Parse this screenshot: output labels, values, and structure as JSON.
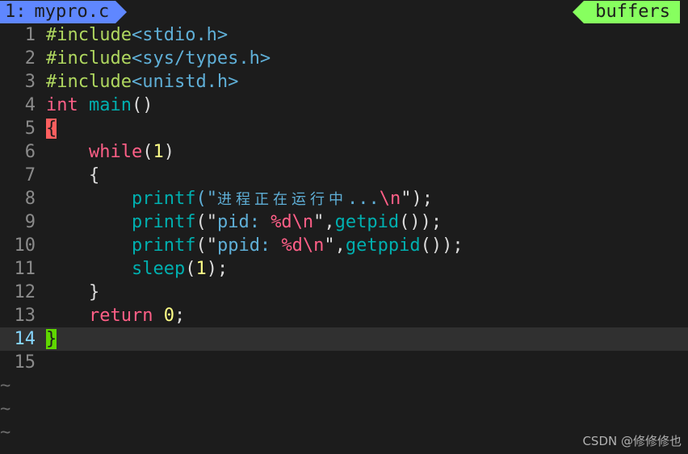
{
  "tabline": {
    "active_tab_number": "1:",
    "active_tab_name": "mypro.c",
    "buffers_label": "buffers"
  },
  "lines": [
    {
      "num": "1"
    },
    {
      "num": "2"
    },
    {
      "num": "3"
    },
    {
      "num": "4"
    },
    {
      "num": "5"
    },
    {
      "num": "6"
    },
    {
      "num": "7"
    },
    {
      "num": "8"
    },
    {
      "num": "9"
    },
    {
      "num": "10"
    },
    {
      "num": "11"
    },
    {
      "num": "12"
    },
    {
      "num": "13"
    },
    {
      "num": "14"
    },
    {
      "num": "15"
    }
  ],
  "code": {
    "l1_pp": "#include",
    "l1_hdr": "<stdio.h>",
    "l2_pp": "#include",
    "l2_hdr": "<sys/types.h>",
    "l3_pp": "#include",
    "l3_hdr": "<unistd.h>",
    "l4_type": "int",
    "l4_func": "main",
    "l4_paren": "()",
    "l5_brace": "{",
    "l6_kw": "while",
    "l6_open": "(",
    "l6_num": "1",
    "l6_close": ")",
    "l7_brace": "{",
    "l8_fn": "printf",
    "l8_open": "(\"",
    "l8_cjk": "进程正在运行中",
    "l8_dots": "...",
    "l8_esc": "\\n",
    "l8_close": "\");",
    "l9_fn": "printf",
    "l9_open": "(\"",
    "l9_str": "pid: ",
    "l9_fmt": "%d\\n",
    "l9_q": "\",",
    "l9_fn2": "getpid",
    "l9_end": "());",
    "l10_fn": "printf",
    "l10_open": "(\"",
    "l10_str": "ppid: ",
    "l10_fmt": "%d\\n",
    "l10_q": "\",",
    "l10_fn2": "getppid",
    "l10_end": "());",
    "l11_fn": "sleep",
    "l11_open": "(",
    "l11_num": "1",
    "l11_close": ");",
    "l12_brace": "}",
    "l13_kw": "return",
    "l13_num": "0",
    "l13_semi": ";",
    "l14_brace": "}"
  },
  "tildes": [
    "~",
    "~",
    "~"
  ],
  "watermark": "CSDN @修修修也",
  "colors": {
    "background": "#1c1c1c",
    "tab_active": "#5f87ff",
    "buffers_tag": "#87ff5f",
    "keyword": "#ff5f87",
    "function": "#00afaf",
    "preprocessor": "#afd75f",
    "string": "#5fafd7",
    "number": "#ffff87",
    "cursor_line": "#303030",
    "brace_match_open": "#ff5f5f",
    "brace_match_close": "#5fd700"
  }
}
